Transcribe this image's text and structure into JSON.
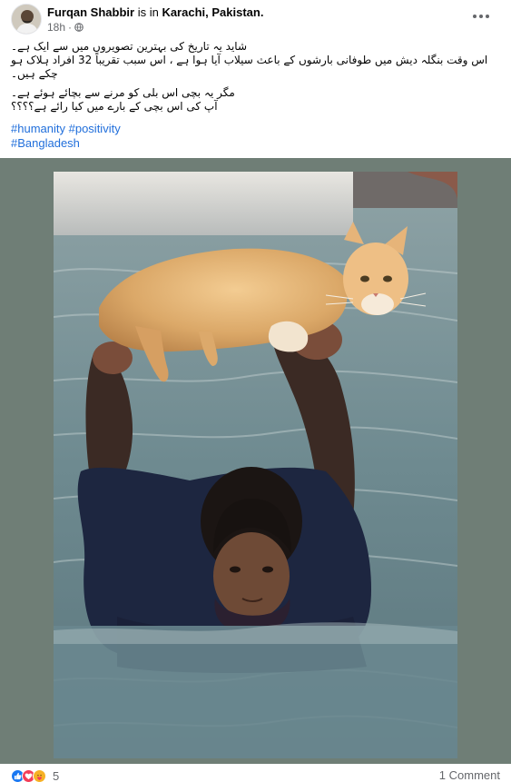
{
  "post": {
    "author": "Furqan Shabbir",
    "location_prefix": "is in",
    "location": "Karachi, Pakistan.",
    "timestamp": "18h",
    "privacy_icon": "globe-icon",
    "more_icon": "more-options-icon",
    "text": {
      "line1": "شاید یہ تاریخ کی بہترین تصویروں میں سے ایک ہے۔",
      "line2": "اس وقت بنگلہ دیش میں طوفانی بارشوں کے باعث سیلاب آیا ہوا ہے ، اس سبب تقریباً 32 افراد ہلاک ہو چکے ہیں۔",
      "line3": "مگر یہ بچی اس بلی کو مرنے سے بچائے ہوئے ہے۔",
      "line4": "آپ کی اس بچی کے بارے میں کیا رائے ہے؟؟؟؟"
    },
    "hashtags": [
      "#humanity",
      "#positivity",
      "#Bangladesh"
    ]
  },
  "footer": {
    "reaction_icons": [
      "like-icon",
      "love-icon",
      "care-icon"
    ],
    "reaction_count": "5",
    "comments_label": "1 Comment"
  },
  "colors": {
    "link": "#216fdb",
    "like": "#1877f2",
    "love": "#f33e58",
    "care": "#f7b125",
    "muted": "#65676b",
    "photo_frame": "#6f7e76"
  }
}
